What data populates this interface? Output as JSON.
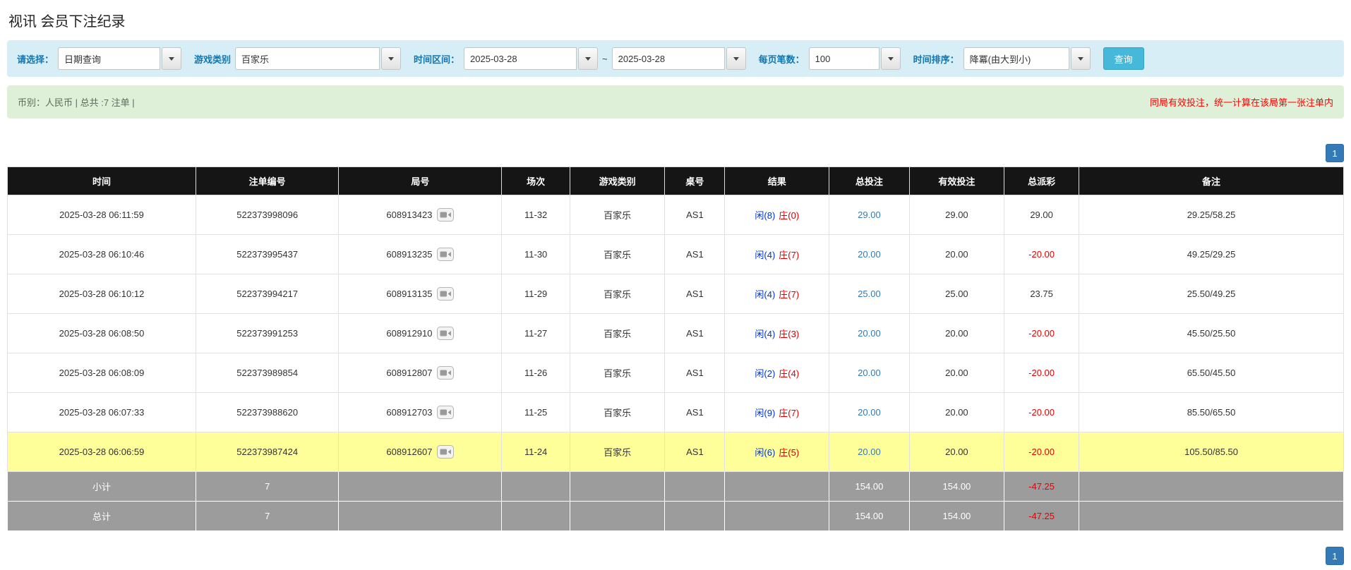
{
  "page": {
    "title": "视讯 会员下注纪录"
  },
  "filters": {
    "select_label": "请选择：",
    "select_value": "日期查询",
    "game_label": "游戏类别",
    "game_value": "百家乐",
    "range_label": "时间区间：",
    "date_from": "2025-03-28",
    "range_separator": "~",
    "date_to": "2025-03-28",
    "per_page_label": "每页笔数：",
    "per_page_value": "100",
    "sort_label": "时间排序：",
    "sort_value": "降冪(由大到小)",
    "search_button": "查询"
  },
  "summary": {
    "left": "币别：人民币 | 总共 :7 注单 |",
    "right": "同局有效投注，统一计算在该局第一张注单内"
  },
  "pagination": {
    "page": "1"
  },
  "table": {
    "headers": [
      "时间",
      "注单编号",
      "局号",
      "场次",
      "游戏类别",
      "桌号",
      "结果",
      "总投注",
      "有效投注",
      "总派彩",
      "备注"
    ],
    "rows": [
      {
        "time": "2025-03-28 06:11:59",
        "bet_id": "522373998096",
        "round_id": "608913423",
        "session": "11-32",
        "game_type": "百家乐",
        "table_no": "AS1",
        "result_player": "闲(8)",
        "result_banker": "庄(0)",
        "total_bet": "29.00",
        "valid_bet": "29.00",
        "payout": "29.00",
        "note": "29.25/58.25",
        "highlighted": false
      },
      {
        "time": "2025-03-28 06:10:46",
        "bet_id": "522373995437",
        "round_id": "608913235",
        "session": "11-30",
        "game_type": "百家乐",
        "table_no": "AS1",
        "result_player": "闲(4)",
        "result_banker": "庄(7)",
        "total_bet": "20.00",
        "valid_bet": "20.00",
        "payout": "-20.00",
        "note": "49.25/29.25",
        "highlighted": false
      },
      {
        "time": "2025-03-28 06:10:12",
        "bet_id": "522373994217",
        "round_id": "608913135",
        "session": "11-29",
        "game_type": "百家乐",
        "table_no": "AS1",
        "result_player": "闲(4)",
        "result_banker": "庄(7)",
        "total_bet": "25.00",
        "valid_bet": "25.00",
        "payout": "23.75",
        "note": "25.50/49.25",
        "highlighted": false
      },
      {
        "time": "2025-03-28 06:08:50",
        "bet_id": "522373991253",
        "round_id": "608912910",
        "session": "11-27",
        "game_type": "百家乐",
        "table_no": "AS1",
        "result_player": "闲(4)",
        "result_banker": "庄(3)",
        "total_bet": "20.00",
        "valid_bet": "20.00",
        "payout": "-20.00",
        "note": "45.50/25.50",
        "highlighted": false
      },
      {
        "time": "2025-03-28 06:08:09",
        "bet_id": "522373989854",
        "round_id": "608912807",
        "session": "11-26",
        "game_type": "百家乐",
        "table_no": "AS1",
        "result_player": "闲(2)",
        "result_banker": "庄(4)",
        "total_bet": "20.00",
        "valid_bet": "20.00",
        "payout": "-20.00",
        "note": "65.50/45.50",
        "highlighted": false
      },
      {
        "time": "2025-03-28 06:07:33",
        "bet_id": "522373988620",
        "round_id": "608912703",
        "session": "11-25",
        "game_type": "百家乐",
        "table_no": "AS1",
        "result_player": "闲(9)",
        "result_banker": "庄(7)",
        "total_bet": "20.00",
        "valid_bet": "20.00",
        "payout": "-20.00",
        "note": "85.50/65.50",
        "highlighted": false
      },
      {
        "time": "2025-03-28 06:06:59",
        "bet_id": "522373987424",
        "round_id": "608912607",
        "session": "11-24",
        "game_type": "百家乐",
        "table_no": "AS1",
        "result_player": "闲(6)",
        "result_banker": "庄(5)",
        "total_bet": "20.00",
        "valid_bet": "20.00",
        "payout": "-20.00",
        "note": "105.50/85.50",
        "highlighted": true
      }
    ],
    "subtotal": {
      "label": "小计",
      "count": "7",
      "total_bet": "154.00",
      "valid_bet": "154.00",
      "payout": "-47.25"
    },
    "total": {
      "label": "总计",
      "count": "7",
      "total_bet": "154.00",
      "valid_bet": "154.00",
      "payout": "-47.25"
    }
  }
}
